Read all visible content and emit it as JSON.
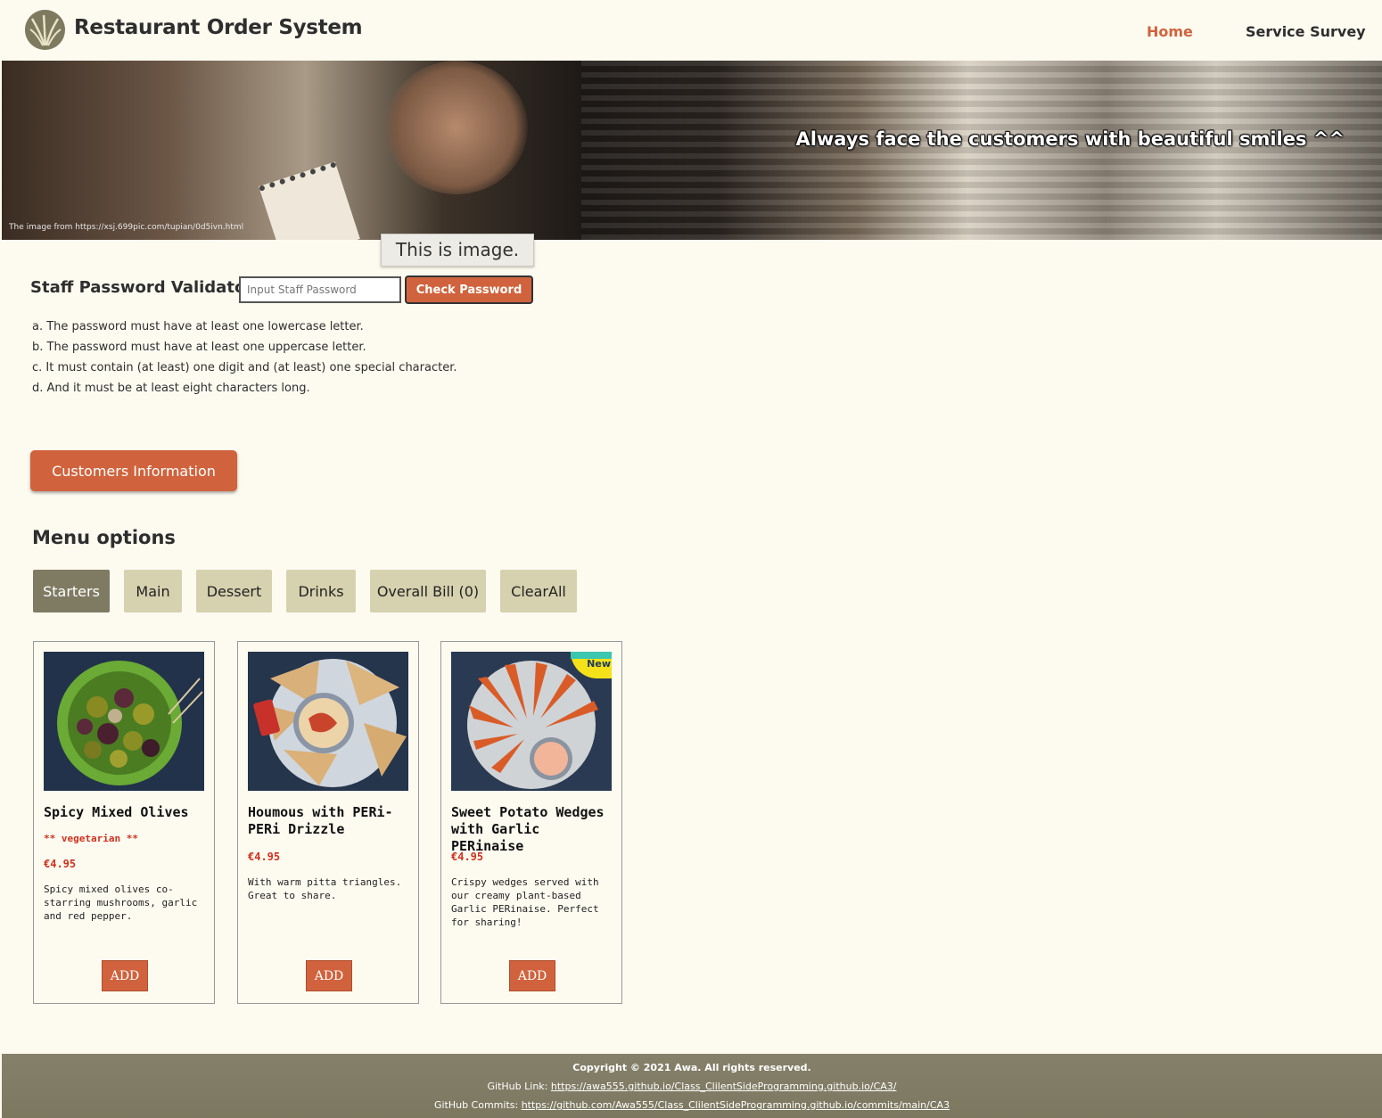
{
  "header": {
    "title": "Restaurant Order System",
    "nav": {
      "home": "Home",
      "survey": "Service Survey"
    }
  },
  "banner": {
    "caption": "Always face the customers with beautiful smiles ^^",
    "credit": "The image from https://xsj.699pic.com/tupian/0d5ivn.html",
    "tooltip": "This is image."
  },
  "password": {
    "label": "Staff Password Validator",
    "placeholder": "Input Staff Password",
    "button": "Check Password",
    "rules": [
      "a. The password must have at least one lowercase letter.",
      "b. The password must have at least one uppercase letter.",
      "c. It must contain (at least) one digit and (at least) one special character.",
      "d. And it must be at least eight characters long."
    ]
  },
  "customers_button": "Customers Information",
  "menu": {
    "heading": "Menu options",
    "tabs": [
      "Starters",
      "Main",
      "Dessert",
      "Drinks",
      "Overall Bill (0)",
      "ClearAll"
    ],
    "active_tab": "Starters",
    "items": [
      {
        "name": "Spicy Mixed Olives",
        "tag": "** vegetarian **",
        "price": "€4.95",
        "desc": "Spicy mixed olives co-starring mushrooms, garlic and red pepper.",
        "button": "ADD"
      },
      {
        "name": "Houmous with PERi-PERi Drizzle",
        "price": "€4.95",
        "desc": "With warm pitta triangles. Great to share.",
        "button": "ADD"
      },
      {
        "name": "Sweet Potato Wedges with Garlic PERinaise",
        "badge": "New",
        "price": "€4.95",
        "desc": "Crispy wedges served with our creamy plant-based Garlic PERinaise. Perfect for sharing!",
        "button": "ADD"
      }
    ]
  },
  "footer": {
    "copyright": "Copyright © 2021 Awa. All rights reserved.",
    "github_label": "GitHub Link:",
    "github_url": "https://awa555.github.io/Class_ClilentSideProgramming.github.io/CA3/",
    "commits_label": "GitHub Commits:",
    "commits_url": "https://github.com/Awa555/Class_ClilentSideProgramming.github.io/commits/main/CA3"
  },
  "colors": {
    "accent": "#d0633d",
    "background": "#fdfbf0",
    "tab": "#d6d1ae",
    "tab_active": "#7f7b63",
    "price": "#d0321e",
    "footer": "#7f7b63"
  }
}
